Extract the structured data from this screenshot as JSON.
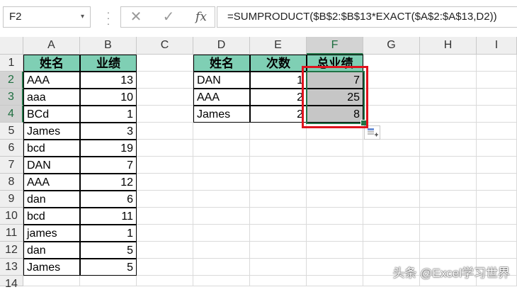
{
  "formula_bar": {
    "name_box": "F2",
    "name_box_arrow": "▾",
    "cancel_icon": "✕",
    "enter_icon": "✓",
    "fx_label": "fx",
    "formula": "=SUMPRODUCT($B$2:$B$13*EXACT($A$2:$A$13,D2))"
  },
  "columns": [
    "A",
    "B",
    "C",
    "D",
    "E",
    "F",
    "G",
    "H",
    "I"
  ],
  "rows": [
    "1",
    "2",
    "3",
    "4",
    "5",
    "6",
    "7",
    "8",
    "9",
    "10",
    "11",
    "12",
    "13",
    "14"
  ],
  "source_table": {
    "headers": [
      "姓名",
      "业绩"
    ],
    "rows": [
      [
        "AAA",
        "13"
      ],
      [
        "aaa",
        "10"
      ],
      [
        "BCd",
        "1"
      ],
      [
        "James",
        "3"
      ],
      [
        "bcd",
        "19"
      ],
      [
        "DAN",
        "7"
      ],
      [
        "AAA",
        "12"
      ],
      [
        "dan",
        "6"
      ],
      [
        "bcd",
        "11"
      ],
      [
        "james",
        "1"
      ],
      [
        "dan",
        "5"
      ],
      [
        "James",
        "5"
      ]
    ]
  },
  "result_table": {
    "headers": [
      "姓名",
      "次数",
      "总业绩"
    ],
    "rows": [
      [
        "DAN",
        "1",
        "7"
      ],
      [
        "AAA",
        "2",
        "25"
      ],
      [
        "James",
        "2",
        "8"
      ]
    ]
  },
  "colors": {
    "header_fill": "#7fcfb4",
    "selection_accent": "#217346",
    "highlight_box": "#e0141e"
  },
  "watermark": "头条 @Excel学习世界"
}
